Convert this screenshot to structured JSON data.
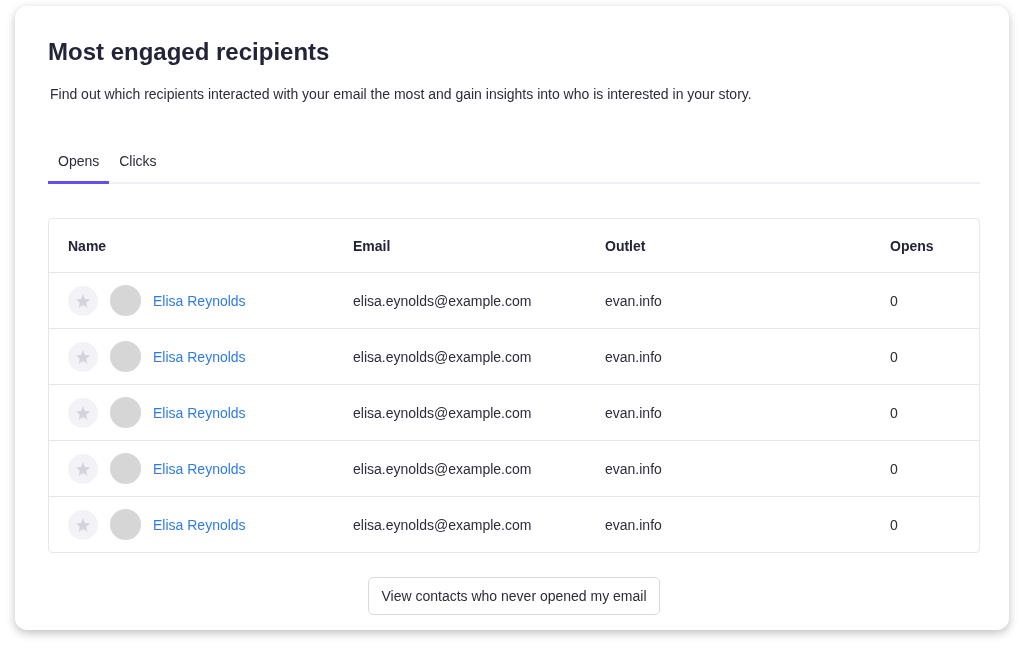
{
  "title": "Most engaged recipients",
  "description": "Find out which recipients interacted with your email the most and gain insights into who is interested in your story.",
  "tabs": [
    {
      "label": "Opens",
      "selected": true
    },
    {
      "label": "Clicks",
      "selected": false
    }
  ],
  "table": {
    "columns": [
      "Name",
      "Email",
      "Outlet",
      "Opens"
    ],
    "rows": [
      {
        "starred": false,
        "name": "Elisa Reynolds",
        "email": "elisa.eynolds@example.com",
        "outlet": "evan.info",
        "opens": "0"
      },
      {
        "starred": false,
        "name": "Elisa Reynolds",
        "email": "elisa.eynolds@example.com",
        "outlet": "evan.info",
        "opens": "0"
      },
      {
        "starred": false,
        "name": "Elisa Reynolds",
        "email": "elisa.eynolds@example.com",
        "outlet": "evan.info",
        "opens": "0"
      },
      {
        "starred": false,
        "name": "Elisa Reynolds",
        "email": "elisa.eynolds@example.com",
        "outlet": "evan.info",
        "opens": "0"
      },
      {
        "starred": false,
        "name": "Elisa Reynolds",
        "email": "elisa.eynolds@example.com",
        "outlet": "evan.info",
        "opens": "0"
      }
    ]
  },
  "button": "View contacts who never opened my email"
}
